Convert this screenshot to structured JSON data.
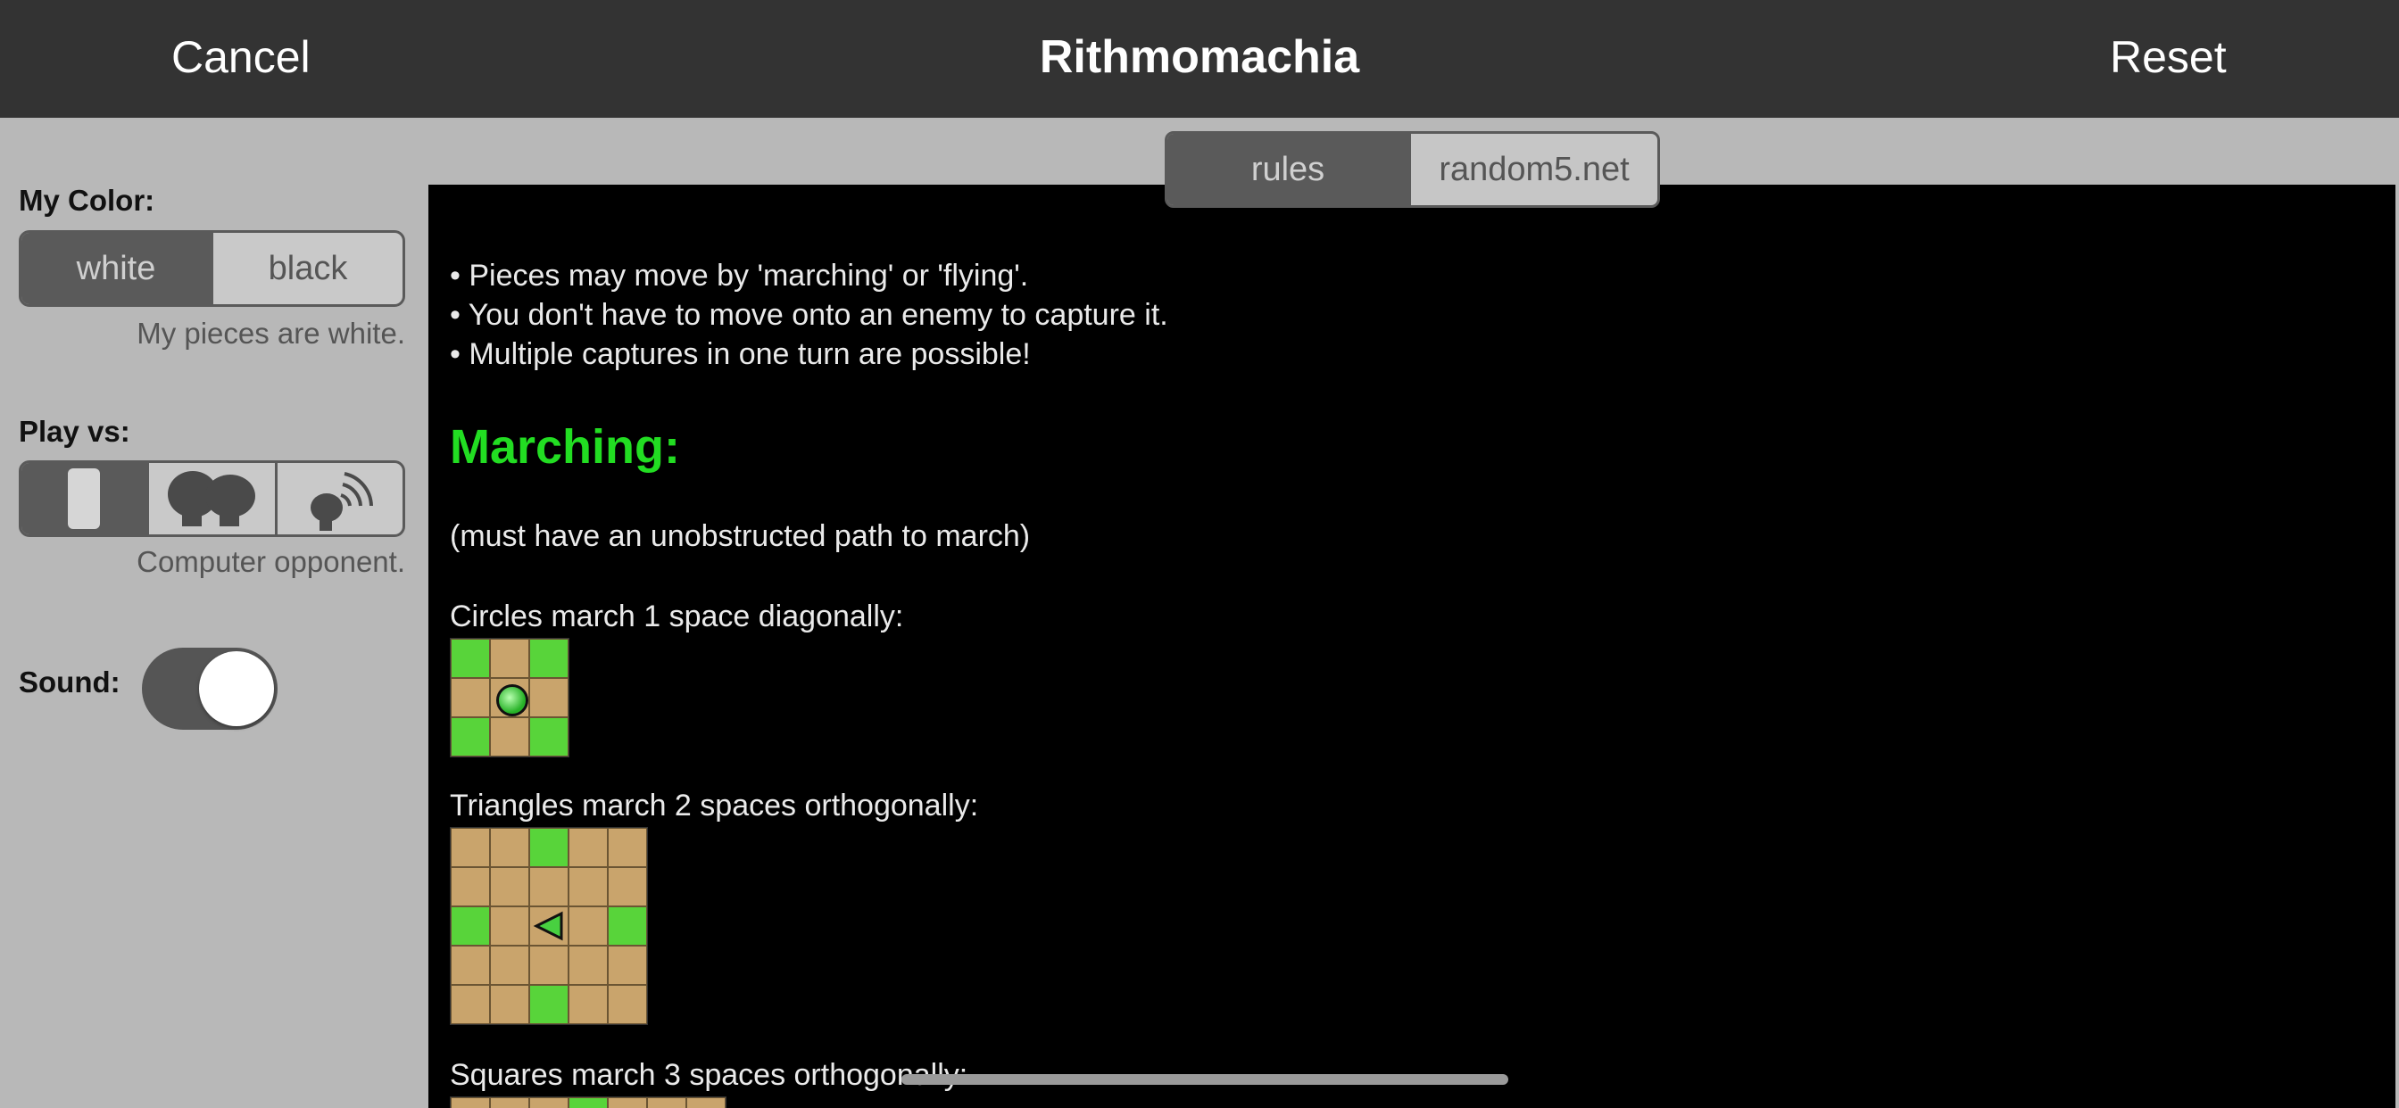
{
  "header": {
    "cancel_label": "Cancel",
    "title": "Rithmomachia",
    "reset_label": "Reset"
  },
  "settings": {
    "my_color_label": "My Color:",
    "color_options": [
      "white",
      "black"
    ],
    "color_selected": "white",
    "color_hint": "My pieces are white.",
    "play_vs_label": "Play vs:",
    "opponent_icons": [
      "phone-icon",
      "two-players-icon",
      "network-icon"
    ],
    "opponent_selected": "phone-icon",
    "opponent_hint": "Computer opponent.",
    "sound_label": "Sound:",
    "sound_on": true
  },
  "tabs": [
    "rules",
    "random5.net"
  ],
  "tab_selected": "rules",
  "rules": {
    "bullets": [
      "• Pieces may move by 'marching' or 'flying'.",
      "• You don't have to move onto an enemy to capture it.",
      "• Multiple captures in one turn are possible!"
    ],
    "marching_heading": "Marching:",
    "path_note": "(must have an unobstructed path to march)",
    "circles_text": "Circles march 1 space diagonally:",
    "triangles_text": "Triangles march 2 spaces orthogonally:",
    "squares_text": "Squares march 3 spaces orthogonally:"
  },
  "colors": {
    "topbar": "#333333",
    "panel": "#b8b8b8",
    "heading_green": "#22dd22",
    "board_tan": "#c9a46c",
    "board_green": "#58d43a"
  }
}
